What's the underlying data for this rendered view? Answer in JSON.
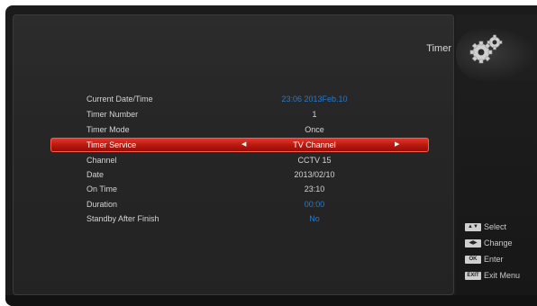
{
  "menu": {
    "title": "Timer",
    "rows": [
      {
        "label": "Current Date/Time",
        "value": "23:06 2013Feb.10"
      },
      {
        "label": "Timer Number",
        "value": "1"
      },
      {
        "label": "Timer Mode",
        "value": "Once"
      },
      {
        "label": "Timer Service",
        "value": "TV Channel"
      },
      {
        "label": "Channel",
        "value": "CCTV 15"
      },
      {
        "label": "Date",
        "value": "2013/02/10"
      },
      {
        "label": "On Time",
        "value": "23:10"
      },
      {
        "label": "Duration",
        "value": "00:00"
      },
      {
        "label": "Standby After Finish",
        "value": "No"
      }
    ]
  },
  "help": [
    {
      "key": "▲▼",
      "label": "Select"
    },
    {
      "key": "◀▶",
      "label": "Change"
    },
    {
      "key": "OK",
      "label": "Enter"
    },
    {
      "key": "EXIT",
      "label": "Exit Menu"
    }
  ],
  "icons": {
    "left_arrow": "◀",
    "right_arrow": "▶"
  },
  "colors": {
    "highlight": "#c41e12",
    "value_blue": "#2a79c8"
  }
}
